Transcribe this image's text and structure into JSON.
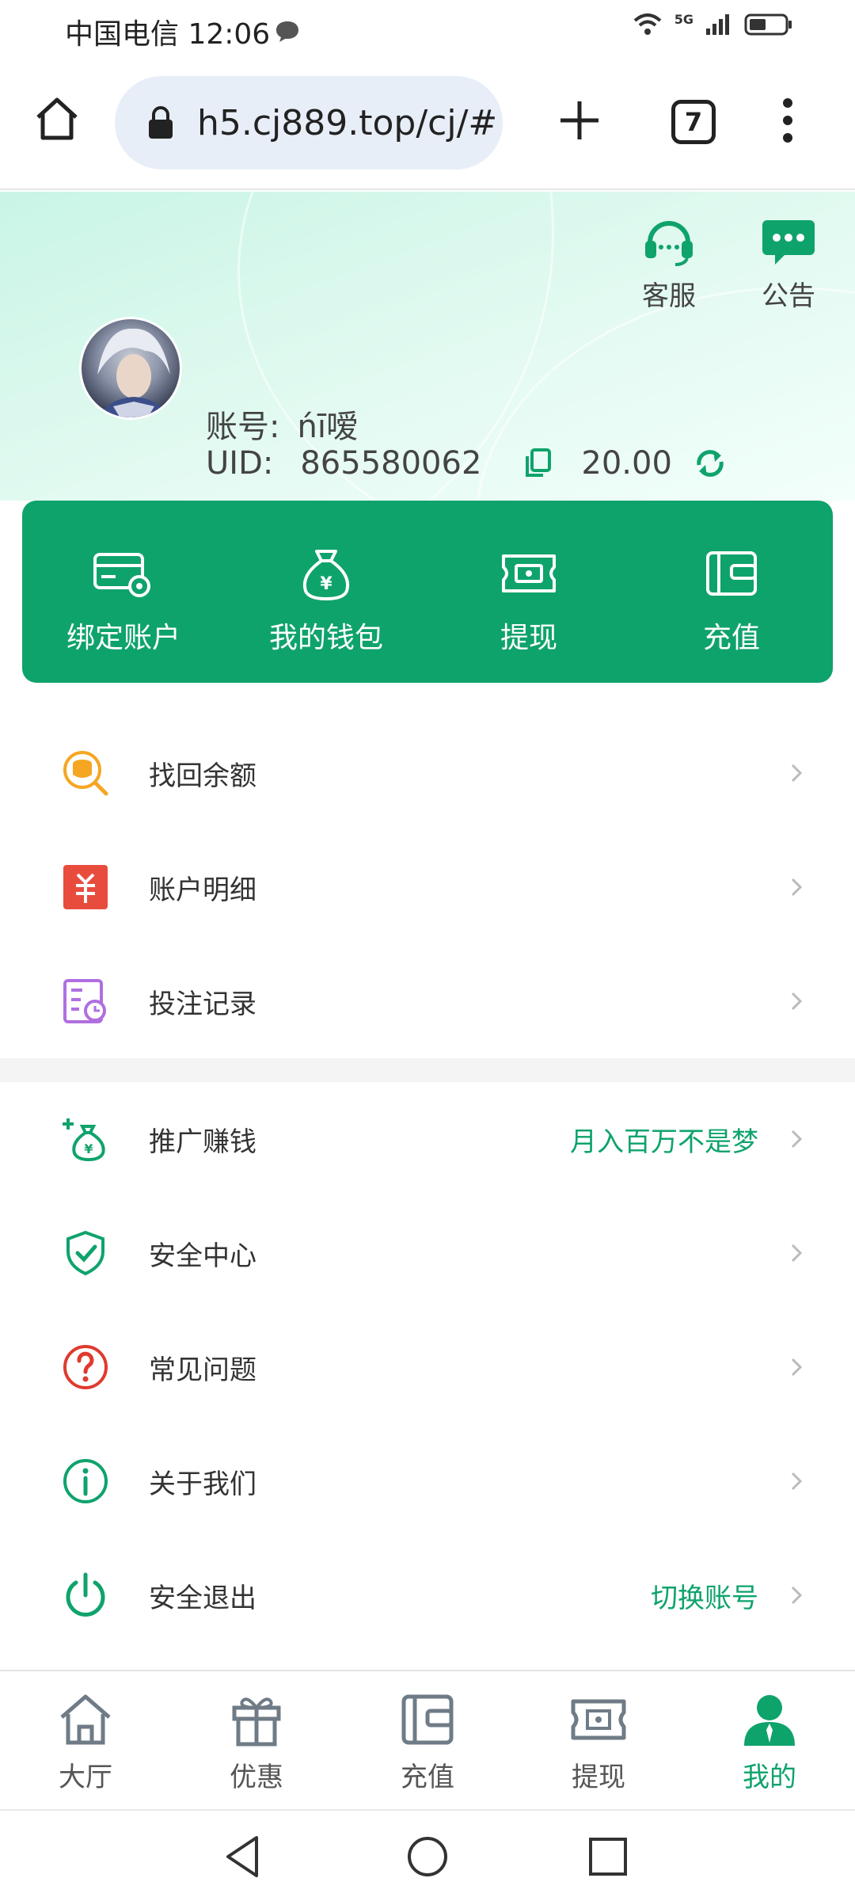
{
  "status_bar": {
    "carrier_time": "中国电信 12:06",
    "network": "5G"
  },
  "browser": {
    "url": "h5.cj889.top/cj/#",
    "tab_count": "7"
  },
  "header": {
    "service_label": "客服",
    "notice_label": "公告",
    "account_label": "账号:",
    "account_value": "ńī嗳",
    "uid_label": "UID:",
    "uid_value": "865580062",
    "balance": "20.00"
  },
  "actions": [
    {
      "label": "绑定账户",
      "icon": "card-settings-icon"
    },
    {
      "label": "我的钱包",
      "icon": "money-bag-icon"
    },
    {
      "label": "提现",
      "icon": "ticket-cash-icon"
    },
    {
      "label": "充值",
      "icon": "wallet-icon"
    }
  ],
  "menu_group_1": [
    {
      "label": "找回余额",
      "icon": "coin-search-icon"
    },
    {
      "label": "账户明细",
      "icon": "ledger-icon"
    },
    {
      "label": "投注记录",
      "icon": "bet-record-icon"
    }
  ],
  "menu_group_2": [
    {
      "label": "推广赚钱",
      "extra": "月入百万不是梦",
      "icon": "promote-icon"
    },
    {
      "label": "安全中心",
      "extra": "",
      "icon": "shield-check-icon"
    },
    {
      "label": "常见问题",
      "extra": "",
      "icon": "question-icon"
    },
    {
      "label": "关于我们",
      "extra": "",
      "icon": "info-icon"
    },
    {
      "label": "安全退出",
      "extra": "切换账号",
      "icon": "power-icon"
    }
  ],
  "bottom_nav": [
    {
      "label": "大厅",
      "icon": "home-icon",
      "active": false
    },
    {
      "label": "优惠",
      "icon": "gift-icon",
      "active": false
    },
    {
      "label": "充值",
      "icon": "wallet-icon",
      "active": false
    },
    {
      "label": "提现",
      "icon": "ticket-cash-icon",
      "active": false
    },
    {
      "label": "我的",
      "icon": "user-icon",
      "active": true
    }
  ],
  "colors": {
    "brand_green": "#0fa36c",
    "header_mint": "#d4f7ea",
    "menu_text": "#333333"
  }
}
